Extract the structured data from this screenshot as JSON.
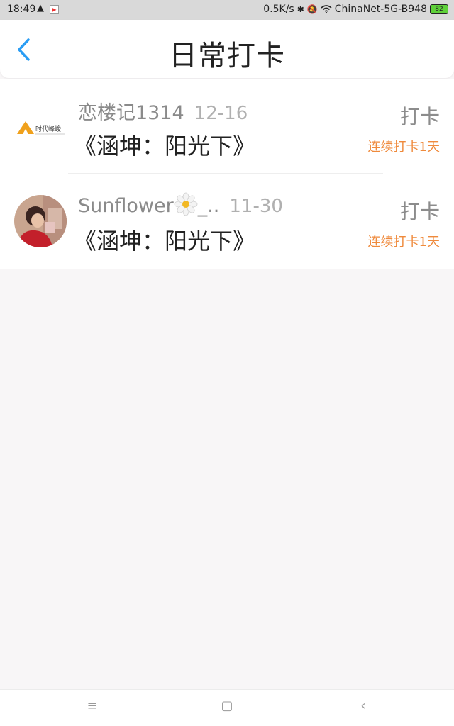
{
  "status_bar": {
    "time": "18:49",
    "alert_glyph": "▲",
    "app_glyph": "▶",
    "net_speed": "0.5K/s",
    "bluetooth_glyph": "✱",
    "mute_glyph": "🔕",
    "wifi_name": "ChinaNet-5G-B948",
    "battery": "82"
  },
  "header": {
    "title": "日常打卡",
    "back_icon": "chevron-left-icon"
  },
  "checkins": [
    {
      "username": "恋楼记1314",
      "date": "12-16",
      "topic": "《涵坤：阳光下》",
      "action_label": "打卡",
      "streak_label": "连续打卡1天",
      "avatar_logo_text": "时代峰峻"
    },
    {
      "username": "Sunflower",
      "username_suffix": "_..",
      "date": "11-30",
      "topic": "《涵坤：阳光下》",
      "action_label": "打卡",
      "streak_label": "连续打卡1天"
    }
  ],
  "nav_bar": {
    "menu_glyph": "≡",
    "home_glyph": "▢",
    "back_glyph": "‹"
  },
  "colors": {
    "accent_blue": "#2a9df4",
    "streak_orange": "#ef8a3c",
    "background": "#f8f6f7"
  }
}
